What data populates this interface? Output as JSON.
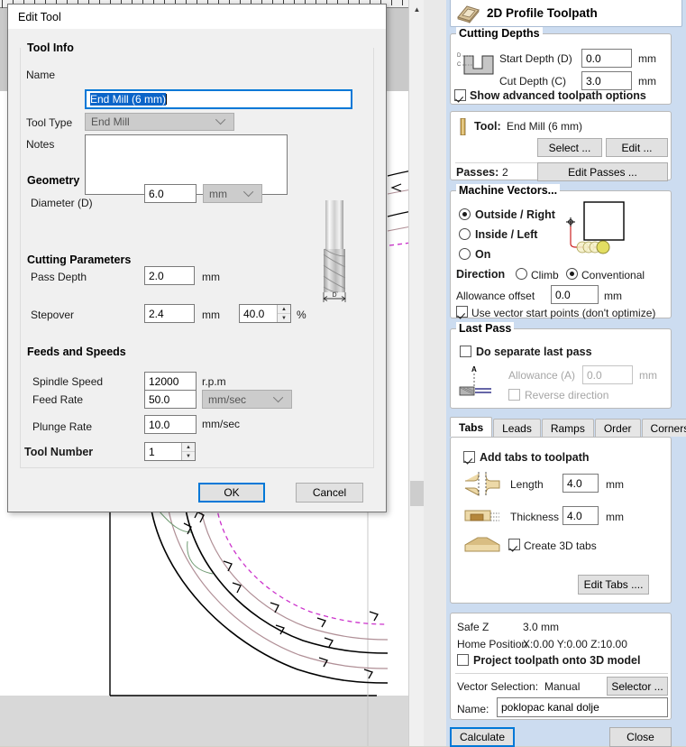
{
  "dialog": {
    "title": "Edit Tool",
    "sections": {
      "tool_info": {
        "title": "Tool Info",
        "name_label": "Name",
        "name_value": "End Mill (6 mm)",
        "tool_type_label": "Tool Type",
        "tool_type_value": "End Mill",
        "notes_label": "Notes",
        "notes_value": ""
      },
      "geometry": {
        "title": "Geometry",
        "diameter_label": "Diameter (D)",
        "diameter_value": "6.0",
        "diameter_unit": "mm",
        "tool_dim_label": "D"
      },
      "cutting_parameters": {
        "title": "Cutting Parameters",
        "pass_depth_label": "Pass Depth",
        "pass_depth_value": "2.0",
        "pass_depth_unit": "mm",
        "stepover_label": "Stepover",
        "stepover_value": "2.4",
        "stepover_unit": "mm",
        "stepover_percent": "40.0",
        "stepover_percent_unit": "%"
      },
      "feeds_and_speeds": {
        "title": "Feeds and Speeds",
        "spindle_speed_label": "Spindle Speed",
        "spindle_speed_value": "12000",
        "spindle_speed_unit": "r.p.m",
        "feed_rate_label": "Feed Rate",
        "feed_rate_value": "50.0",
        "feed_rate_unit": "mm/sec",
        "plunge_rate_label": "Plunge Rate",
        "plunge_rate_value": "10.0",
        "plunge_rate_unit": "mm/sec",
        "tool_number_label": "Tool Number",
        "tool_number_value": "1"
      }
    },
    "ok_label": "OK",
    "cancel_label": "Cancel"
  },
  "toolpath": {
    "header_title": "2D Profile Toolpath",
    "cutting_depths": {
      "title": "Cutting Depths",
      "start_depth_label": "Start Depth (D)",
      "start_depth_value": "0.0",
      "start_depth_unit": "mm",
      "cut_depth_label": "Cut Depth (C)",
      "cut_depth_value": "3.0",
      "cut_depth_unit": "mm",
      "show_advanced_label": "Show advanced toolpath options",
      "show_advanced_checked": true,
      "icon_d_label": "D",
      "icon_c_label": "C"
    },
    "tool": {
      "label": "Tool:",
      "value": "End Mill (6 mm)",
      "select_label": "Select ...",
      "edit_label": "Edit ...",
      "passes_label": "Passes:",
      "passes_value": "2",
      "edit_passes_label": "Edit Passes ..."
    },
    "machine_vectors": {
      "title": "Machine Vectors...",
      "options": [
        {
          "label": "Outside / Right",
          "selected": true
        },
        {
          "label": "Inside / Left",
          "selected": false
        },
        {
          "label": "On",
          "selected": false
        }
      ],
      "direction_label": "Direction",
      "direction_options": [
        {
          "label": "Climb",
          "selected": false
        },
        {
          "label": "Conventional",
          "selected": true
        }
      ],
      "allowance_offset_label": "Allowance offset",
      "allowance_offset_value": "0.0",
      "allowance_offset_unit": "mm",
      "use_vector_start_label": "Use vector start points (don't optimize)",
      "use_vector_start_checked": true
    },
    "last_pass": {
      "title": "Last Pass",
      "do_separate_label": "Do separate last pass",
      "do_separate_checked": false,
      "allowance_label": "Allowance (A)",
      "allowance_value": "0.0",
      "allowance_unit": "mm",
      "reverse_direction_label": "Reverse direction",
      "reverse_direction_checked": false,
      "icon_a_label": "A"
    },
    "tabs_strip": [
      {
        "label": "Tabs",
        "active": true
      },
      {
        "label": "Leads",
        "active": false
      },
      {
        "label": "Ramps",
        "active": false
      },
      {
        "label": "Order",
        "active": false
      },
      {
        "label": "Corners",
        "active": false
      }
    ],
    "tabs_panel": {
      "add_tabs_label": "Add tabs to toolpath",
      "add_tabs_checked": true,
      "length_label": "Length",
      "length_value": "4.0",
      "length_unit": "mm",
      "thickness_label": "Thickness",
      "thickness_value": "4.0",
      "thickness_unit": "mm",
      "create_3d_label": "Create 3D tabs",
      "create_3d_checked": true,
      "edit_tabs_label": "Edit Tabs ...."
    },
    "footer": {
      "safe_z_label": "Safe Z",
      "safe_z_value": "3.0 mm",
      "home_position_label": "Home Position",
      "home_position_value": "X:0.00 Y:0.00 Z:10.00",
      "project_toolpath_label": "Project toolpath onto 3D model",
      "project_toolpath_checked": false,
      "vector_selection_label": "Vector Selection:",
      "vector_selection_value": "Manual",
      "selector_label": "Selector ...",
      "name_label": "Name:",
      "name_value": "poklopac kanal dolje",
      "calculate_label": "Calculate",
      "close_label": "Close"
    }
  },
  "colors": {
    "accent": "#0078d7",
    "panel_bg": "#ccdcf0",
    "dialog_bg": "#f0f0f0",
    "selection": "#0b64c8",
    "toolpath_line": "#000000",
    "offset_line": "#b08f96",
    "dashed_line": "#cc33cc",
    "tab_wood": "#e8c98d"
  }
}
